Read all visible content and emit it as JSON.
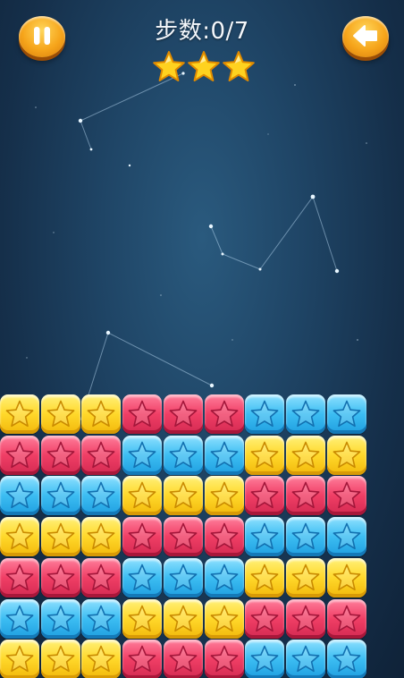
{
  "header": {
    "moves_text": "步数:0/7",
    "stars_earned": 3,
    "stars_total": 3,
    "pause_button_icon": "pause-icon",
    "back_button_icon": "back-arrow-icon"
  },
  "colors": {
    "yellow": "#ffd82a",
    "red": "#f03e65",
    "blue": "#3cbdf2",
    "button": "#f6a51b",
    "star": "#ffd21f"
  },
  "board": {
    "columns": 9,
    "visible_rows": 7,
    "rows": [
      [
        "yellow",
        "yellow",
        "yellow",
        "red",
        "red",
        "red",
        "blue",
        "blue",
        "blue"
      ],
      [
        "red",
        "red",
        "red",
        "blue",
        "blue",
        "blue",
        "yellow",
        "yellow",
        "yellow"
      ],
      [
        "blue",
        "blue",
        "blue",
        "yellow",
        "yellow",
        "yellow",
        "red",
        "red",
        "red"
      ],
      [
        "yellow",
        "yellow",
        "yellow",
        "red",
        "red",
        "red",
        "blue",
        "blue",
        "blue"
      ],
      [
        "red",
        "red",
        "red",
        "blue",
        "blue",
        "blue",
        "yellow",
        "yellow",
        "yellow"
      ],
      [
        "blue",
        "blue",
        "blue",
        "yellow",
        "yellow",
        "yellow",
        "red",
        "red",
        "red"
      ],
      [
        "yellow",
        "yellow",
        "yellow",
        "red",
        "red",
        "red",
        "blue",
        "blue",
        "blue"
      ]
    ]
  }
}
